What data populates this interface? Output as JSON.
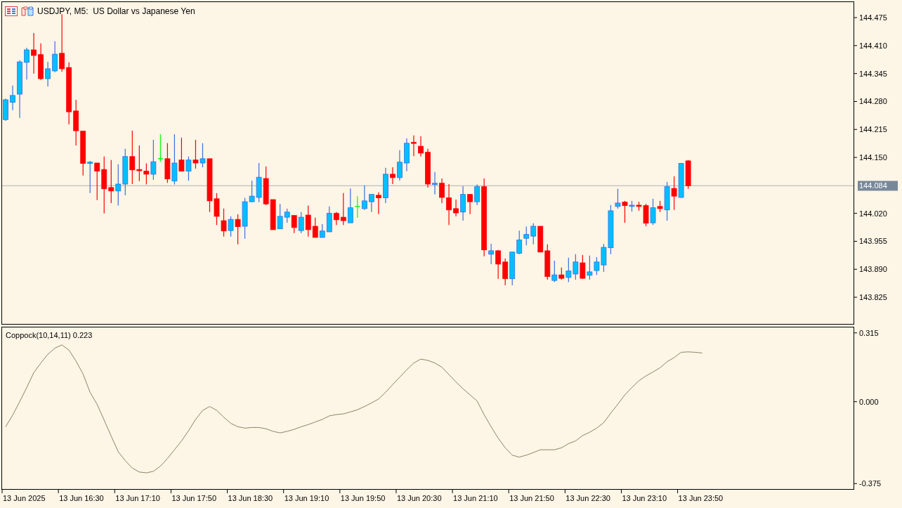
{
  "chart": {
    "title": "USDJPY, M5:  US Dollar vs Japanese Yen",
    "chart_data": {
      "type": "candlestick",
      "ylim": [
        143.763,
        144.511
      ],
      "categories": [
        null,
        null,
        null,
        null,
        null,
        null,
        null,
        null,
        null,
        null,
        null,
        null,
        null,
        null,
        null,
        null,
        null,
        null,
        null,
        null,
        null,
        null,
        null,
        null,
        null,
        null,
        null,
        null,
        null,
        null,
        null,
        null,
        null,
        null,
        null,
        null,
        null,
        null,
        null,
        null,
        null,
        null,
        null,
        null,
        null,
        null,
        null,
        null,
        null,
        null,
        null,
        null,
        null,
        null,
        null,
        null,
        null,
        null,
        null,
        null,
        null,
        null,
        null,
        null,
        null,
        null,
        null,
        null,
        null,
        null,
        null,
        null,
        null,
        null,
        null,
        null,
        null,
        null,
        null,
        null,
        null,
        null,
        null,
        null,
        null,
        null,
        null,
        null,
        null,
        null,
        null,
        null,
        null,
        null,
        null,
        null,
        null,
        null,
        null,
        null,
        null,
        null,
        null,
        null,
        null,
        null,
        null,
        null,
        null,
        null,
        null,
        null,
        null,
        null,
        null,
        null,
        null,
        null,
        null,
        null,
        null
      ],
      "yticks": [
        {
          "value": 144.475,
          "label": "144.475"
        },
        {
          "value": 144.41,
          "label": "144.410"
        },
        {
          "value": 144.345,
          "label": "144.345"
        },
        {
          "value": 144.28,
          "label": "144.280"
        },
        {
          "value": 144.215,
          "label": "144.215"
        },
        {
          "value": 144.15,
          "label": "144.150"
        },
        {
          "value": 144.02,
          "label": "144.020"
        },
        {
          "value": 143.955,
          "label": "143.955"
        },
        {
          "value": 143.89,
          "label": "143.890"
        },
        {
          "value": 143.825,
          "label": "143.825"
        }
      ],
      "ref_lines": [
        {
          "axis": "y",
          "value": 144.084,
          "label": "144.084"
        }
      ],
      "ohlc": [
        [
          144.238,
          144.287,
          144.235,
          144.284
        ],
        [
          144.278,
          144.317,
          144.26,
          144.294
        ],
        [
          144.297,
          144.376,
          144.242,
          144.372
        ],
        [
          144.371,
          144.405,
          144.331,
          144.4
        ],
        [
          144.4,
          144.439,
          144.345,
          144.387
        ],
        [
          144.389,
          144.415,
          144.33,
          144.333
        ],
        [
          144.333,
          144.372,
          144.315,
          144.356
        ],
        [
          144.351,
          144.42,
          144.348,
          144.39
        ],
        [
          144.392,
          144.483,
          144.349,
          144.356
        ],
        [
          144.359,
          144.371,
          144.227,
          144.256
        ],
        [
          144.258,
          144.284,
          144.178,
          144.212
        ],
        [
          144.211,
          144.211,
          144.108,
          144.136
        ],
        [
          144.136,
          144.142,
          144.067,
          144.139
        ],
        [
          144.137,
          144.137,
          144.051,
          144.118
        ],
        [
          144.122,
          144.152,
          144.02,
          144.077
        ],
        [
          144.08,
          144.144,
          144.044,
          144.072
        ],
        [
          144.072,
          144.134,
          144.038,
          144.088
        ],
        [
          144.088,
          144.17,
          144.062,
          144.152
        ],
        [
          144.152,
          144.212,
          144.088,
          144.121
        ],
        [
          144.122,
          144.178,
          144.095,
          144.119
        ],
        [
          144.118,
          144.136,
          144.087,
          144.111
        ],
        [
          144.111,
          144.191,
          144.098,
          144.14
        ],
        [
          144.147,
          144.204,
          144.14,
          144.147
        ],
        [
          144.147,
          144.183,
          144.091,
          144.1
        ],
        [
          144.095,
          144.204,
          144.087,
          144.137
        ],
        [
          144.144,
          144.196,
          144.118,
          144.118
        ],
        [
          144.118,
          144.152,
          144.096,
          144.144
        ],
        [
          144.144,
          144.191,
          144.124,
          144.137
        ],
        [
          144.137,
          144.183,
          144.127,
          144.147
        ],
        [
          144.147,
          144.147,
          144.023,
          144.049
        ],
        [
          144.054,
          144.067,
          143.993,
          144.013
        ],
        [
          144.003,
          144.031,
          143.966,
          143.979
        ],
        [
          143.98,
          144.013,
          143.966,
          144.006
        ],
        [
          144.006,
          144.018,
          143.948,
          143.989
        ],
        [
          143.99,
          144.056,
          143.961,
          144.047
        ],
        [
          144.047,
          144.096,
          144.046,
          144.06
        ],
        [
          144.057,
          144.137,
          144.046,
          144.104
        ],
        [
          144.101,
          144.129,
          144.039,
          144.042
        ],
        [
          144.052,
          144.052,
          143.982,
          143.982
        ],
        [
          143.984,
          144.042,
          143.984,
          144.013
        ],
        [
          144.011,
          144.031,
          143.998,
          144.023
        ],
        [
          144.015,
          144.015,
          143.974,
          143.987
        ],
        [
          143.98,
          144.023,
          143.974,
          144.011
        ],
        [
          144.016,
          144.038,
          143.966,
          143.982
        ],
        [
          143.99,
          144.01,
          143.964,
          143.964
        ],
        [
          143.964,
          143.995,
          143.964,
          143.979
        ],
        [
          143.977,
          144.036,
          143.977,
          144.02
        ],
        [
          144.02,
          144.023,
          143.993,
          144.005
        ],
        [
          144.011,
          144.067,
          143.993,
          144.003
        ],
        [
          143.998,
          144.078,
          143.998,
          144.033
        ],
        [
          144.036,
          144.06,
          144.01,
          144.036
        ],
        [
          144.031,
          144.085,
          144.028,
          144.049
        ],
        [
          144.047,
          144.064,
          144.023,
          144.064
        ],
        [
          144.062,
          144.069,
          144.018,
          144.056
        ],
        [
          144.056,
          144.126,
          144.044,
          144.111
        ],
        [
          144.111,
          144.127,
          144.088,
          144.103
        ],
        [
          144.103,
          144.167,
          144.096,
          144.139
        ],
        [
          144.137,
          144.194,
          144.118,
          144.183
        ],
        [
          144.185,
          144.201,
          144.153,
          144.183
        ],
        [
          144.176,
          144.199,
          144.152,
          144.16
        ],
        [
          144.162,
          144.17,
          144.08,
          144.088
        ],
        [
          144.087,
          144.116,
          144.064,
          144.09
        ],
        [
          144.09,
          144.101,
          144.044,
          144.057
        ],
        [
          144.056,
          144.088,
          143.993,
          144.028
        ],
        [
          144.031,
          144.052,
          144.013,
          144.021
        ],
        [
          144.023,
          144.083,
          144.003,
          144.064
        ],
        [
          144.064,
          144.064,
          144.018,
          144.047
        ],
        [
          144.047,
          144.087,
          144.039,
          144.082
        ],
        [
          144.082,
          144.101,
          143.92,
          143.935
        ],
        [
          143.925,
          143.949,
          143.902,
          143.933
        ],
        [
          143.933,
          143.935,
          143.868,
          143.902
        ],
        [
          143.907,
          143.915,
          143.853,
          143.868
        ],
        [
          143.868,
          143.93,
          143.853,
          143.93
        ],
        [
          143.927,
          143.98,
          143.925,
          143.958
        ],
        [
          143.962,
          143.989,
          143.946,
          143.971
        ],
        [
          143.967,
          143.997,
          143.948,
          143.99
        ],
        [
          143.99,
          143.99,
          143.93,
          143.93
        ],
        [
          143.933,
          143.948,
          143.866,
          143.873
        ],
        [
          143.864,
          143.91,
          143.86,
          143.877
        ],
        [
          143.877,
          143.894,
          143.866,
          143.869
        ],
        [
          143.871,
          143.917,
          143.86,
          143.886
        ],
        [
          143.879,
          143.925,
          143.866,
          143.907
        ],
        [
          143.905,
          143.923,
          143.868,
          143.869
        ],
        [
          143.876,
          143.922,
          143.866,
          143.884
        ],
        [
          143.887,
          143.918,
          143.877,
          143.907
        ],
        [
          143.9,
          143.949,
          143.884,
          143.941
        ],
        [
          143.94,
          144.039,
          143.925,
          144.026
        ],
        [
          144.036,
          144.077,
          144.031,
          144.044
        ],
        [
          144.046,
          144.049,
          143.998,
          144.038
        ],
        [
          144.036,
          144.049,
          144.024,
          144.039
        ],
        [
          144.039,
          144.047,
          144.026,
          144.036
        ],
        [
          144.038,
          144.042,
          143.99,
          143.997
        ],
        [
          143.998,
          144.054,
          143.993,
          144.033
        ],
        [
          144.036,
          144.049,
          144.023,
          144.031
        ],
        [
          144.028,
          144.093,
          144.003,
          144.082
        ],
        [
          144.078,
          144.106,
          144.028,
          144.06
        ],
        [
          144.057,
          144.137,
          144.056,
          144.136
        ],
        [
          144.142,
          144.144,
          144.077,
          144.084
        ],
        null,
        null,
        null,
        null,
        null,
        null,
        null,
        null,
        null,
        null,
        null,
        null,
        null,
        null,
        null,
        null,
        null,
        null,
        null,
        null,
        null,
        null,
        null
      ]
    }
  },
  "indicator": {
    "label": "Coppock(10,14,11) 0.223",
    "chart_data": {
      "type": "line",
      "ylim": [
        -0.4,
        0.34
      ],
      "categories": [
        null,
        null,
        null,
        null,
        null,
        null,
        null,
        null,
        null,
        null,
        null,
        null,
        null,
        null,
        null,
        null,
        null,
        null,
        null,
        null,
        null,
        null,
        null,
        null,
        null,
        null,
        null,
        null,
        null,
        null,
        null,
        null,
        null,
        null,
        null,
        null,
        null,
        null,
        null,
        null,
        null,
        null,
        null,
        null,
        null,
        null,
        null,
        null,
        null,
        null,
        null,
        null,
        null,
        null,
        null,
        null,
        null,
        null,
        null,
        null,
        null,
        null,
        null,
        null,
        null,
        null,
        null,
        null,
        null,
        null,
        null,
        null,
        null,
        null,
        null,
        null,
        null,
        null,
        null,
        null,
        null,
        null,
        null,
        null,
        null,
        null,
        null,
        null,
        null,
        null,
        null,
        null,
        null,
        null,
        null,
        null,
        null,
        null,
        null,
        null,
        null,
        null,
        null,
        null,
        null,
        null,
        null,
        null,
        null,
        null,
        null,
        null,
        null,
        null,
        null,
        null,
        null,
        null,
        null,
        null,
        null
      ],
      "yticks": [
        {
          "value": 0.315,
          "label": "0.315"
        },
        {
          "value": 0,
          "label": "0.000"
        },
        {
          "value": -0.375,
          "label": "-0.375"
        }
      ],
      "series": [
        {
          "color": "#8b8468",
          "values": [
            -0.115,
            -0.062,
            0.0,
            0.065,
            0.133,
            0.177,
            0.217,
            0.245,
            0.26,
            0.236,
            0.186,
            0.127,
            0.043,
            -0.012,
            -0.084,
            -0.158,
            -0.229,
            -0.27,
            -0.304,
            -0.322,
            -0.326,
            -0.319,
            -0.295,
            -0.26,
            -0.22,
            -0.18,
            -0.133,
            -0.081,
            -0.04,
            -0.022,
            -0.04,
            -0.071,
            -0.099,
            -0.115,
            -0.121,
            -0.118,
            -0.118,
            -0.124,
            -0.136,
            -0.143,
            -0.136,
            -0.127,
            -0.115,
            -0.105,
            -0.093,
            -0.081,
            -0.065,
            -0.059,
            -0.056,
            -0.047,
            -0.037,
            -0.022,
            -0.006,
            0.012,
            0.043,
            0.078,
            0.112,
            0.146,
            0.177,
            0.195,
            0.189,
            0.177,
            0.158,
            0.124,
            0.09,
            0.059,
            0.031,
            0.003,
            -0.059,
            -0.115,
            -0.167,
            -0.211,
            -0.245,
            -0.254,
            -0.245,
            -0.233,
            -0.22,
            -0.22,
            -0.22,
            -0.211,
            -0.192,
            -0.18,
            -0.155,
            -0.14,
            -0.121,
            -0.096,
            -0.053,
            -0.012,
            0.031,
            0.065,
            0.096,
            0.118,
            0.136,
            0.155,
            0.183,
            0.202,
            0.226,
            0.228,
            0.226,
            0.223,
            null,
            null,
            null,
            null,
            null,
            null,
            null,
            null,
            null,
            null,
            null,
            null,
            null,
            null,
            null,
            null,
            null,
            null,
            null,
            null,
            null
          ]
        }
      ]
    }
  },
  "time_axis": {
    "labels": [
      "13 Jun 2025",
      "13 Jun 16:30",
      "13 Jun 17:10",
      "13 Jun 17:50",
      "13 Jun 18:30",
      "13 Jun 19:10",
      "13 Jun 19:50",
      "13 Jun 20:30",
      "13 Jun 21:10",
      "13 Jun 21:50",
      "13 Jun 22:30",
      "13 Jun 23:10",
      "13 Jun 23:50"
    ]
  }
}
